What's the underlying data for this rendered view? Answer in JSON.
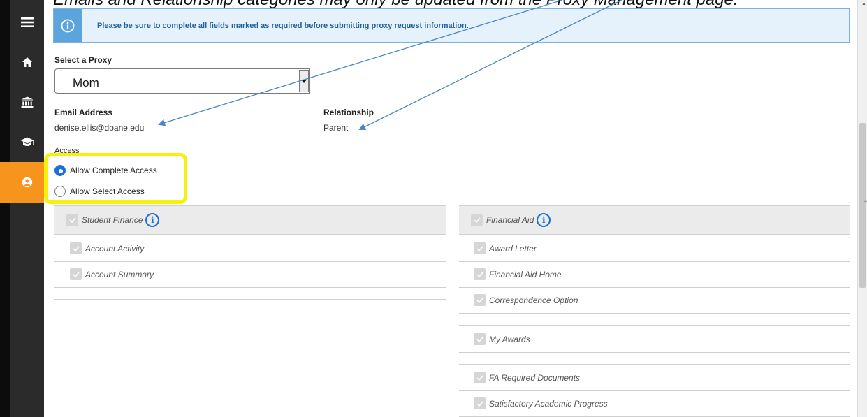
{
  "top_note": "Emails and Relationship categories may only be updated from the Proxy Management page.",
  "nav": {
    "items": [
      {
        "icon": "menu-icon"
      },
      {
        "icon": "home-icon"
      },
      {
        "icon": "bank-icon"
      },
      {
        "icon": "graduation-cap-icon"
      },
      {
        "icon": "user-circle-icon",
        "active": true
      }
    ]
  },
  "banner": {
    "icon": "info-icon",
    "text": "Please be sure to complete all fields marked as required before submitting proxy request information."
  },
  "proxy": {
    "label": "Select a Proxy",
    "value": "Mom"
  },
  "email": {
    "label": "Email Address",
    "value": "denise.ellis@doane.edu"
  },
  "relationship": {
    "label": "Relationship",
    "value": "Parent"
  },
  "access": {
    "label": "Access",
    "options": [
      {
        "label": "Allow Complete Access",
        "checked": true
      },
      {
        "label": "Allow Select Access",
        "checked": false
      }
    ]
  },
  "student_finance": {
    "title": "Student Finance",
    "items": [
      "Account Activity",
      "Account Summary"
    ]
  },
  "financial_aid": {
    "title": "Financial Aid",
    "items": [
      "Award Letter",
      "Financial Aid Home",
      "Correspondence Option",
      "My Awards",
      "FA Required Documents",
      "Satisfactory Academic Progress"
    ]
  },
  "colors": {
    "accent": "#f7941d",
    "highlight": "#f6f00d",
    "arrow": "#4a86c8",
    "radio": "#1b6fd6"
  }
}
